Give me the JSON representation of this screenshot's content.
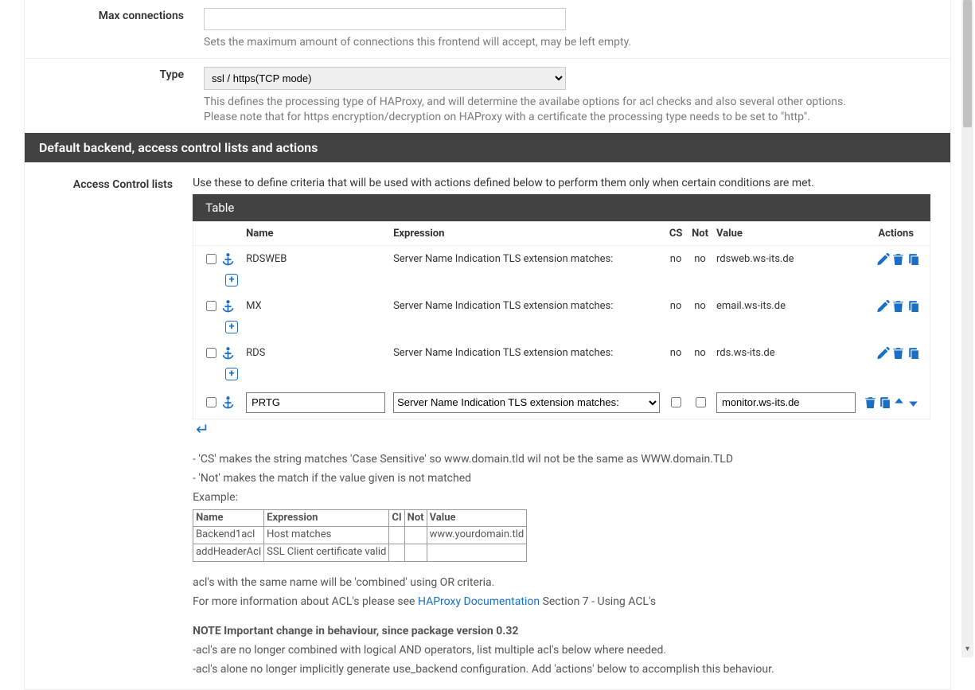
{
  "fields": {
    "max_connections": {
      "label": "Max connections",
      "value": "",
      "help": "Sets the maximum amount of connections this frontend will accept, may be left empty."
    },
    "type": {
      "label": "Type",
      "value": "ssl / https(TCP mode)",
      "help1": "This defines the processing type of HAProxy, and will determine the availabe options for acl checks and also several other options.",
      "help2": "Please note that for https encryption/decryption on HAProxy with a certificate the processing type needs to be set to \"http\"."
    }
  },
  "section_title": "Default backend, access control lists and actions",
  "acl": {
    "label": "Access Control lists",
    "desc": "Use these to define criteria that will be used with actions defined below to perform them only when certain conditions are met.",
    "table_title": "Table",
    "headers": {
      "name": "Name",
      "expression": "Expression",
      "cs": "CS",
      "not": "Not",
      "value": "Value",
      "actions": "Actions"
    },
    "rows": [
      {
        "name": "RDSWEB",
        "expression": "Server Name Indication TLS extension matches:",
        "cs": "no",
        "not": "no",
        "value": "rdsweb.ws-its.de"
      },
      {
        "name": "MX",
        "expression": "Server Name Indication TLS extension matches:",
        "cs": "no",
        "not": "no",
        "value": "email.ws-its.de"
      },
      {
        "name": "RDS",
        "expression": "Server Name Indication TLS extension matches:",
        "cs": "no",
        "not": "no",
        "value": "rds.ws-its.de"
      }
    ],
    "edit": {
      "name": "PRTG",
      "expression": "Server Name Indication TLS extension matches:",
      "value": "monitor.ws-its.de"
    }
  },
  "notes": {
    "line1": "- 'CS' makes the string matches 'Case Sensitive' so www.domain.tld wil not be the same as WWW.domain.TLD",
    "line2": "- 'Not' makes the match if the value given is not matched",
    "example_label": "Example:",
    "example_headers": {
      "name": "Name",
      "expression": "Expression",
      "ci": "CI",
      "not": "Not",
      "value": "Value"
    },
    "example_rows": [
      {
        "name": "Backend1acl",
        "expression": "Host matches",
        "ci": "",
        "not": "",
        "value": "www.yourdomain.tld"
      },
      {
        "name": "addHeaderAcl",
        "expression": "SSL Client certificate valid",
        "ci": "",
        "not": "",
        "value": ""
      }
    ],
    "combined": "acl's with the same name will be 'combined' using OR criteria.",
    "moreinfo_pre": "For more information about ACL's please see ",
    "moreinfo_link": "HAProxy Documentation",
    "moreinfo_post": " Section 7 - Using ACL's",
    "note_bold": "NOTE Important change in behaviour, since package version 0.32",
    "note_a": "-acl's are no longer combined with logical AND operators, list multiple acl's below where needed.",
    "note_b": "-acl's alone no longer implicitly generate use_backend configuration. Add 'actions' below to accomplish this behaviour."
  }
}
